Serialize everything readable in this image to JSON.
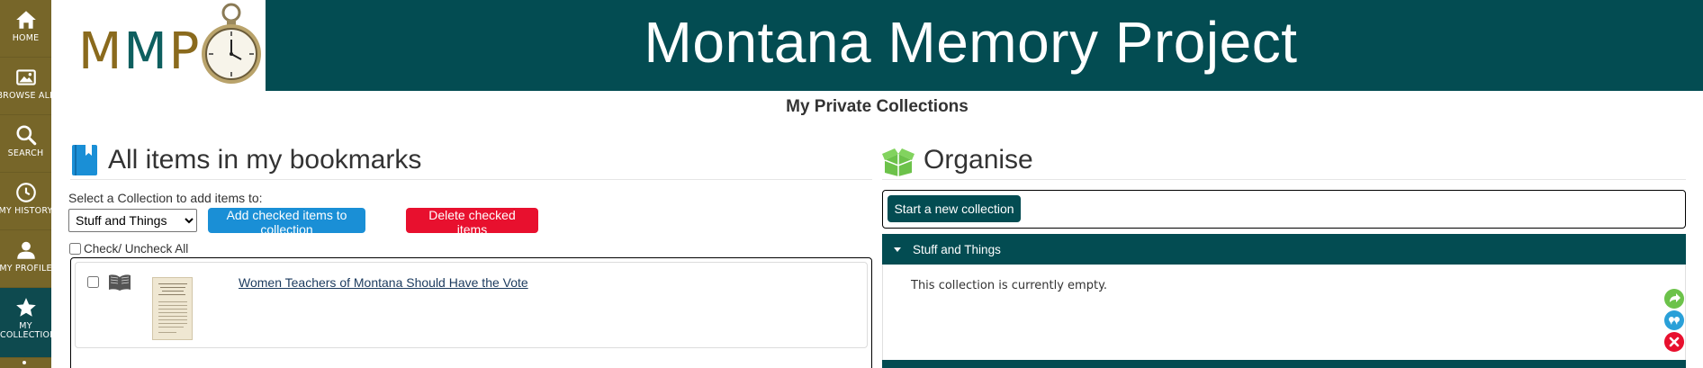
{
  "sidebar": {
    "items": [
      {
        "label": "HOME",
        "icon": "home-icon"
      },
      {
        "label": "BROWSE ALL",
        "icon": "image-icon"
      },
      {
        "label": "SEARCH",
        "icon": "search-icon"
      },
      {
        "label": "MY HISTORY",
        "icon": "clock-icon"
      },
      {
        "label": "MY PROFILE",
        "icon": "user-icon"
      },
      {
        "label": "MY COLLECTION",
        "icon": "star-icon",
        "active": true
      }
    ],
    "colors": {
      "background": "#776629",
      "active": "#0e4a4f"
    }
  },
  "header": {
    "logo": {
      "letters_1": "M",
      "letters_2": "M",
      "letters_3": "P"
    },
    "site_title": "Montana Memory Project",
    "banner_color": "#034c52"
  },
  "page": {
    "title": "My Private Collections"
  },
  "bookmarks": {
    "heading": "All items in my bookmarks",
    "select_label": "Select a Collection to add items to:",
    "selected_collection": "Stuff and Things",
    "add_button": "Add checked items to collection",
    "delete_button": "Delete checked items",
    "check_all_label": "Check/ Uncheck All",
    "items": [
      {
        "title": "Women Teachers of Montana Should Have the Vote",
        "checked": false
      }
    ]
  },
  "organise": {
    "heading": "Organise",
    "new_collection_button": "Start a new collection",
    "collections": [
      {
        "name": "Stuff and Things",
        "expanded": true,
        "empty_message": "This collection is currently empty."
      }
    ],
    "action_icons": [
      "share-icon",
      "quote-icon",
      "delete-icon"
    ],
    "colors": {
      "accent": "#034c52",
      "green": "#6cc24a",
      "blue": "#2aa0d8",
      "red": "#e8102e"
    }
  }
}
